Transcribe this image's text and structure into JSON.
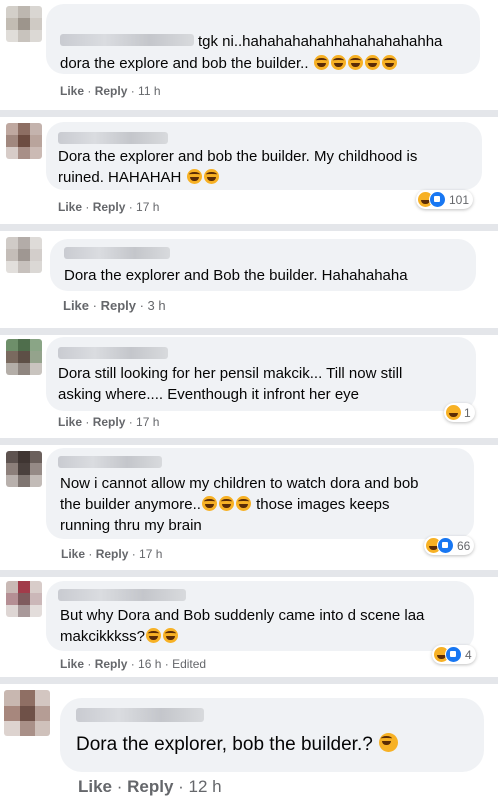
{
  "comments": [
    {
      "line1": "tgk ni..hahahahahahhahahahahahha",
      "line2": "dora the explore and bob the builder..",
      "like": "Like",
      "reply": "Reply",
      "time": "11 h"
    },
    {
      "line1": "Dora the explorer and bob the builder. My childhood is",
      "line2": "ruined. HAHAHAH",
      "like": "Like",
      "reply": "Reply",
      "time": "17 h",
      "reactions": "101"
    },
    {
      "line1": "Dora the explorer and Bob the builder. Hahahahaha",
      "like": "Like",
      "reply": "Reply",
      "time": "3 h"
    },
    {
      "line1": "Dora still looking for her pensil makcik... Till now still",
      "line2": "asking where.... Eventhough it infront her eye",
      "like": "Like",
      "reply": "Reply",
      "time": "17 h",
      "reactions": "1"
    },
    {
      "line1": "Now i cannot allow my children to watch dora and bob",
      "line2a": "the builder anymore..",
      "line2b": "those images keeps",
      "line3": "running thru my brain",
      "like": "Like",
      "reply": "Reply",
      "time": "17 h",
      "reactions": "66"
    },
    {
      "line1": "But why Dora and Bob suddenly came into d scene laa",
      "line2": "makcikkkss?",
      "like": "Like",
      "reply": "Reply",
      "time": "16 h",
      "edited": "Edited",
      "reactions": "4"
    },
    {
      "line1": "Dora the explorer, bob the builder.?",
      "like": "Like",
      "reply": "Reply",
      "time": "12 h"
    }
  ]
}
